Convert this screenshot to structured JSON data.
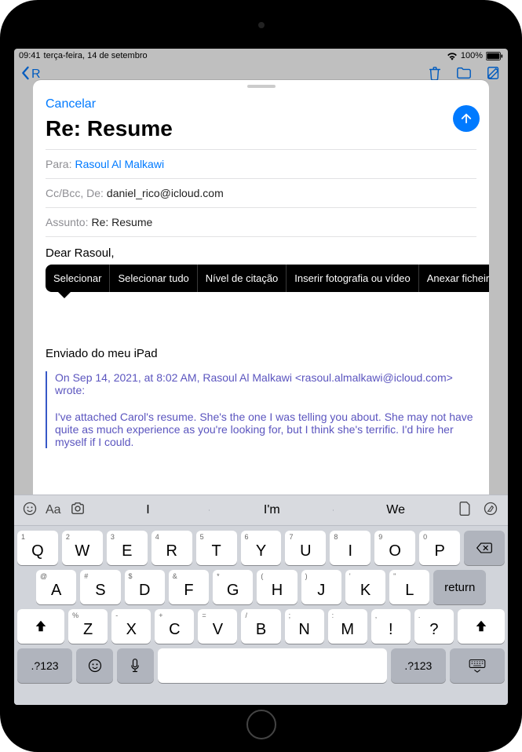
{
  "status": {
    "time": "09:41",
    "date": "terça-feira, 14 de setembro",
    "battery": "100%"
  },
  "navbar": {
    "back_label": "R"
  },
  "compose": {
    "cancel": "Cancelar",
    "title": "Re: Resume",
    "to_label": "Para:",
    "to_value": "Rasoul Al Malkawi",
    "ccbcc_label": "Cc/Bcc, De:",
    "ccbcc_value": "daniel_rico@icloud.com",
    "subject_label": "Assunto:",
    "subject_value": "Re: Resume",
    "body_greeting": "Dear Rasoul,",
    "signature": "Enviado do meu iPad",
    "quote_header": "On Sep 14, 2021, at 8:02 AM, Rasoul Al Malkawi <rasoul.almalkawi@icloud.com> wrote:",
    "quote_body": "I've attached Carol's resume. She's the one I was telling you about. She may not have quite as much experience as you're looking for, but I think she's terrific. I'd hire her myself if I could."
  },
  "context_menu": {
    "items": [
      "Selecionar",
      "Selecionar tudo",
      "Nível de citação",
      "Inserir fotografia ou vídeo",
      "Anexar ficheiro"
    ]
  },
  "suggestions": [
    "I",
    "I'm",
    "We"
  ],
  "keyboard": {
    "row1": [
      {
        "main": "Q",
        "sub": "1"
      },
      {
        "main": "W",
        "sub": "2"
      },
      {
        "main": "E",
        "sub": "3"
      },
      {
        "main": "R",
        "sub": "4"
      },
      {
        "main": "T",
        "sub": "5"
      },
      {
        "main": "Y",
        "sub": "6"
      },
      {
        "main": "U",
        "sub": "7"
      },
      {
        "main": "I",
        "sub": "8"
      },
      {
        "main": "O",
        "sub": "9"
      },
      {
        "main": "P",
        "sub": "0"
      }
    ],
    "row2": [
      {
        "main": "A",
        "sub": "@"
      },
      {
        "main": "S",
        "sub": "#"
      },
      {
        "main": "D",
        "sub": "$"
      },
      {
        "main": "F",
        "sub": "&"
      },
      {
        "main": "G",
        "sub": "*"
      },
      {
        "main": "H",
        "sub": "("
      },
      {
        "main": "J",
        "sub": ")"
      },
      {
        "main": "K",
        "sub": "'"
      },
      {
        "main": "L",
        "sub": "\""
      }
    ],
    "row3": [
      {
        "main": "Z",
        "sub": "%"
      },
      {
        "main": "X",
        "sub": "-"
      },
      {
        "main": "C",
        "sub": "+"
      },
      {
        "main": "V",
        "sub": "="
      },
      {
        "main": "B",
        "sub": "/"
      },
      {
        "main": "N",
        "sub": ";"
      },
      {
        "main": "M",
        "sub": ":"
      },
      {
        "main": "!",
        "sub": ","
      },
      {
        "main": "?",
        "sub": "."
      }
    ],
    "num_label": ".?123",
    "return_label": "return"
  }
}
